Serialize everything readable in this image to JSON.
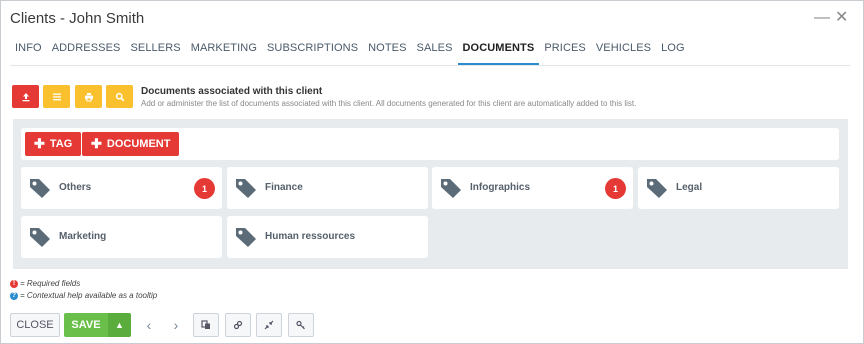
{
  "window": {
    "title": "Clients - John Smith",
    "minimize_icon": "minimize-icon",
    "close_icon": "close-icon"
  },
  "tabs": [
    {
      "label": "INFO"
    },
    {
      "label": "ADDRESSES"
    },
    {
      "label": "SELLERS"
    },
    {
      "label": "MARKETING"
    },
    {
      "label": "SUBSCRIPTIONS"
    },
    {
      "label": "NOTES"
    },
    {
      "label": "SALES"
    },
    {
      "label": "DOCUMENTS",
      "active": true
    },
    {
      "label": "PRICES"
    },
    {
      "label": "VEHICLES"
    },
    {
      "label": "LOG"
    }
  ],
  "toolbar_icons": [
    "upload-icon",
    "list-icon",
    "print-icon",
    "search-icon"
  ],
  "documents": {
    "heading": "Documents associated with this client",
    "description": "Add or administer the list of documents associated with this client. All documents generated for this client are automatically added to this list."
  },
  "actions": {
    "tag_label": "TAG",
    "document_label": "DOCUMENT"
  },
  "tags": [
    {
      "label": "Others",
      "count": "1"
    },
    {
      "label": "Finance",
      "count": ""
    },
    {
      "label": "Infographics",
      "count": "1"
    },
    {
      "label": "Legal",
      "count": ""
    },
    {
      "label": "Marketing",
      "count": ""
    },
    {
      "label": "Human ressources",
      "count": ""
    }
  ],
  "legend": {
    "required": "= Required fields",
    "help": "= Contextual help available as a tooltip"
  },
  "footer": {
    "close_label": "CLOSE",
    "save_label": "SAVE"
  },
  "colors": {
    "red": "#e53935",
    "yellow": "#fbc02d",
    "green": "#6abf4b",
    "accent": "#2a8ccf"
  }
}
